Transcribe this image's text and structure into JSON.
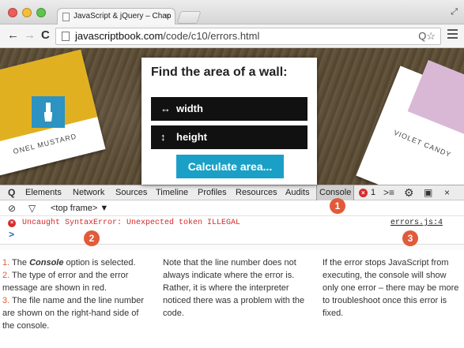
{
  "browser": {
    "tab_title": "JavaScript & jQuery – Chap",
    "tab_close": "×",
    "url_host": "javascriptbook.com",
    "url_path": "/code/c10/errors.html",
    "back": "←",
    "forward": "→",
    "reload": "C",
    "resize": "⤢",
    "omni_icons": "Q☆"
  },
  "webpage": {
    "heading": "Find the area of a wall:",
    "field_width": {
      "icon": "↔",
      "label": "width"
    },
    "field_height": {
      "icon": "↕",
      "label": "height"
    },
    "button": "Calculate area...",
    "swatch_left": "ONEL MUSTARD",
    "swatch_right": "VIOLET CANDY"
  },
  "devtools": {
    "search_icon": "Q",
    "tabs": [
      "Elements",
      "Network",
      "Sources",
      "Timeline",
      "Profiles",
      "Resources",
      "Audits",
      "Console"
    ],
    "selected_tab": "Console",
    "error_count": "1",
    "frame_selector": "<top frame>",
    "frame_arrow": "▼",
    "error_message": "Uncaught SyntaxError: Unexpected token ILLEGAL",
    "error_source": "errors.js:4",
    "prompt": ">",
    "colors": {
      "error": "#d02a2a",
      "callout": "#e15b3a",
      "accent": "#1aa0c6"
    }
  },
  "callouts": [
    "1",
    "2",
    "3"
  ],
  "captions": {
    "col1": [
      {
        "num": "1.",
        "pre": " The ",
        "em": "Console",
        "post": " option is selected."
      },
      {
        "num": "2.",
        "text": " The type of error and the error message are shown in red."
      },
      {
        "num": "3.",
        "text": " The file name and the line number are shown on the right-hand side of the console."
      }
    ],
    "col2": "Note that the line number does not always  indicate where the error is. Rather, it is where the interpreter noticed there was a problem with the code.",
    "col3": "If the error stops JavaScript from executing, the console will show only one error – there may be more to troubleshoot once this error is fixed."
  }
}
